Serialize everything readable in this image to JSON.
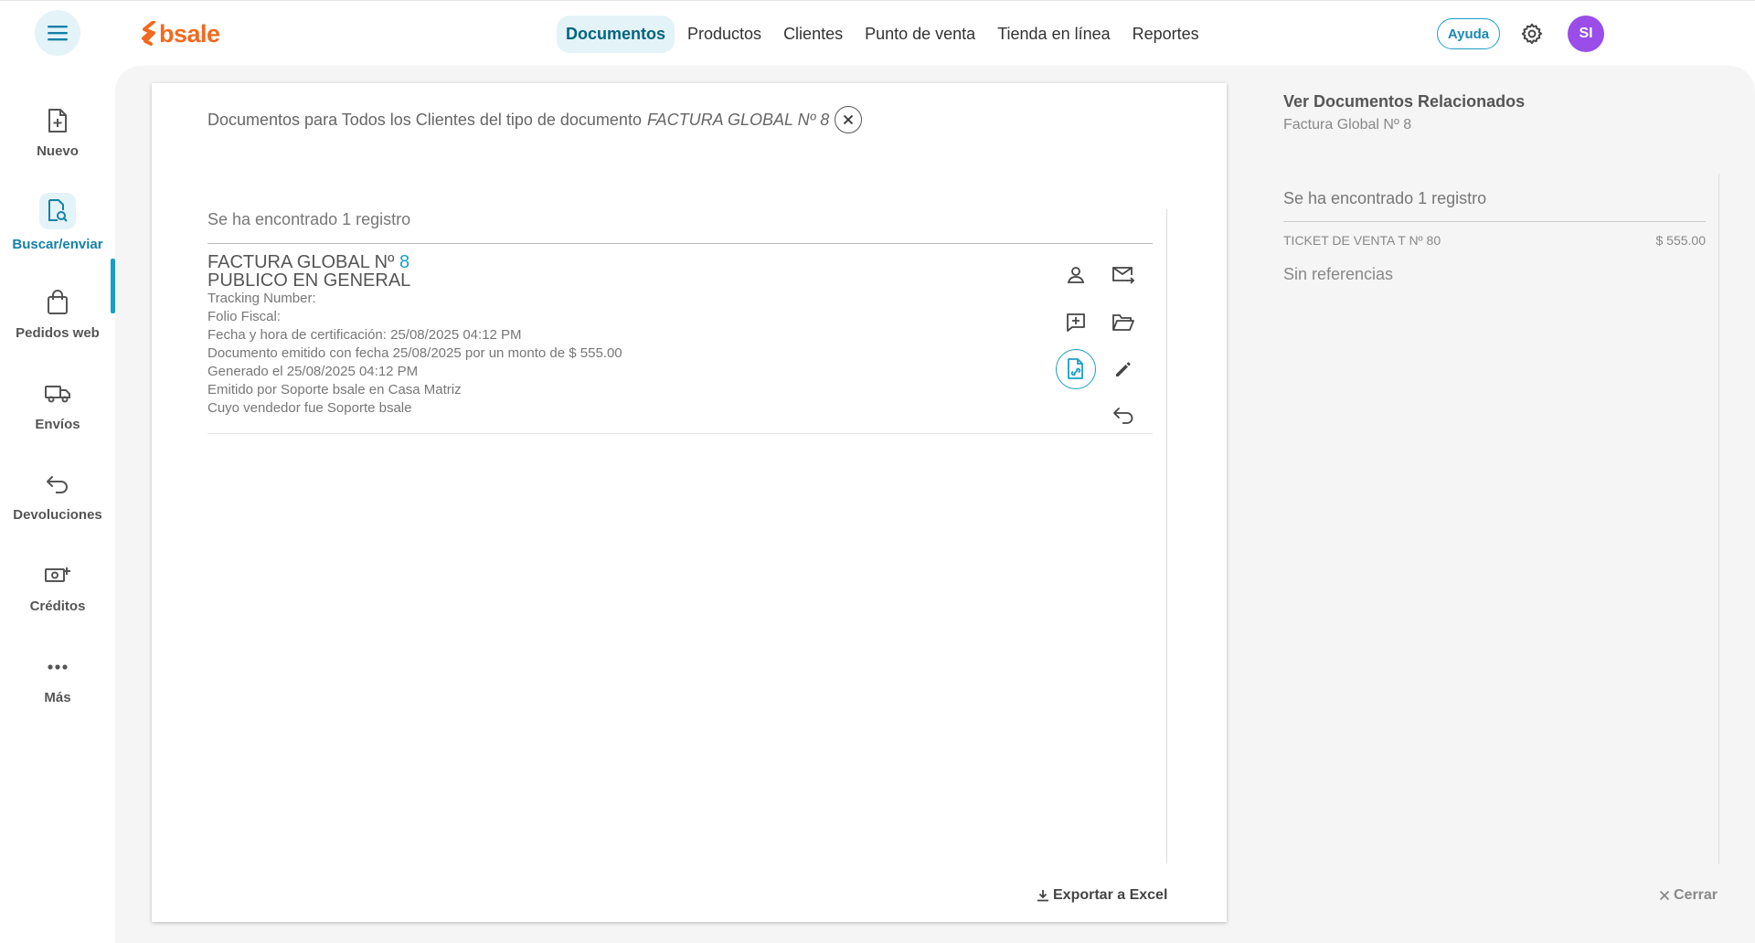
{
  "header": {
    "brand": "bsale",
    "nav": [
      {
        "label": "Documentos",
        "active": true
      },
      {
        "label": "Productos"
      },
      {
        "label": "Clientes"
      },
      {
        "label": "Punto de venta"
      },
      {
        "label": "Tienda en línea"
      },
      {
        "label": "Reportes"
      }
    ],
    "help_label": "Ayuda",
    "avatar_initials": "SI",
    "accent_color": "#1a9ec4",
    "brand_color": "#f26a1f",
    "avatar_color": "#9a4de8"
  },
  "sidebar": {
    "items": [
      {
        "label": "Nuevo",
        "icon": "file-plus-icon"
      },
      {
        "label": "Buscar/enviar",
        "icon": "file-search-icon",
        "active": true
      },
      {
        "label": "Pedidos web",
        "icon": "shopping-bag-icon"
      },
      {
        "label": "Envíos",
        "icon": "truck-icon"
      },
      {
        "label": "Devoluciones",
        "icon": "return-arrow-icon"
      },
      {
        "label": "Créditos",
        "icon": "money-plus-icon"
      },
      {
        "label": "Más",
        "icon": "more-dots-icon"
      }
    ]
  },
  "documents": {
    "filter_prefix": "Documentos para Todos los Clientes del tipo de documento",
    "filter_value": "FACTURA GLOBAL Nº 8",
    "found_text": "Se ha encontrado 1 registro",
    "rows": [
      {
        "doc_type": "FACTURA GLOBAL Nº",
        "doc_number": "8",
        "client": "PUBLICO EN GENERAL",
        "lines": [
          "Tracking Number:",
          "Folio Fiscal:",
          "Fecha y hora de certificación: 25/08/2025 04:12 PM",
          "Documento emitido con fecha 25/08/2025 por un monto de $ 555.00",
          "Generado el 25/08/2025 04:12 PM",
          "Emitido por Soporte bsale en Casa Matriz",
          "Cuyo vendedor fue Soporte bsale"
        ]
      }
    ],
    "export_label": "Exportar a Excel"
  },
  "related": {
    "title": "Ver Documentos Relacionados",
    "subtitle": "Factura Global Nº 8",
    "found_text": "Se ha encontrado 1 registro",
    "items": [
      {
        "name": "TICKET DE VENTA T Nº 80",
        "amount": "$ 555.00"
      }
    ],
    "no_refs": "Sin referencias",
    "close_label": "Cerrar"
  }
}
